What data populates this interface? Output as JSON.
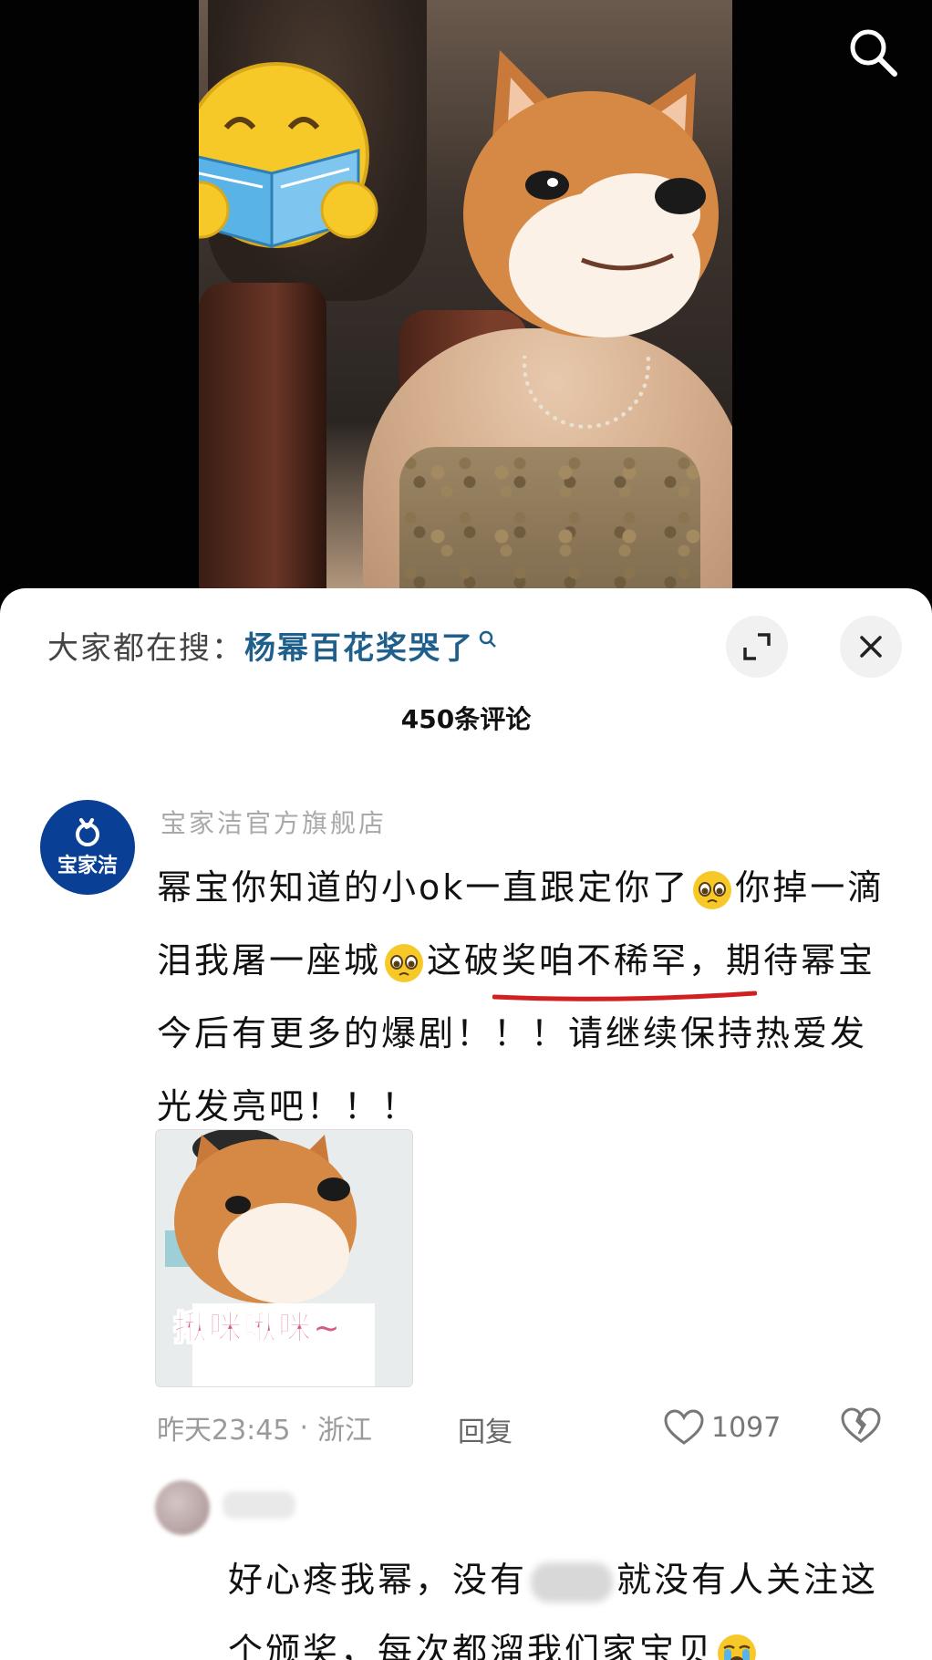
{
  "search": {
    "icon": "search-icon"
  },
  "sheet": {
    "hot_search_prefix": "大家都在搜：",
    "hot_search_term": "杨幂百花奖哭了",
    "comment_count": "450条评论"
  },
  "comment1": {
    "avatar_text": "宝家洁",
    "username": "宝家洁官方旗舰店",
    "text_part1": "幂宝你知道的小ok一直跟定你了",
    "text_part2": "你掉一滴泪我屠一座城",
    "text_part3": "这破奖咱不稀罕，期待幂宝今后有更多的爆剧！！！请继续保持热爱发光发亮吧！！！",
    "sticker_text": "揪咪啾咪~",
    "time": "昨天23:45",
    "location": "浙江",
    "separator": "·",
    "reply": "回复",
    "likes": "1097"
  },
  "comment2": {
    "text_part1": "好心疼我幂，没有",
    "text_part2": "就没有人关注这个颁奖，每次都溜我们家宝贝"
  }
}
